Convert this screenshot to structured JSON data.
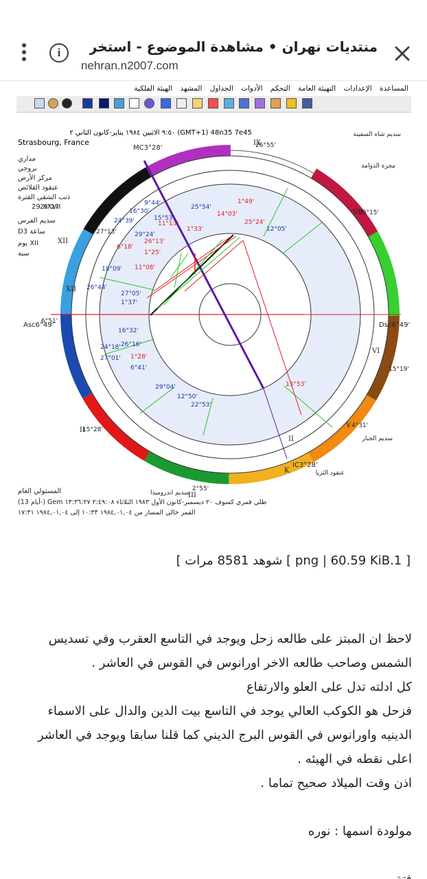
{
  "browser": {
    "title": "منتديات نهران • مشاهدة الموضوع - استخرج اس..",
    "url": "nehran.n2007.com"
  },
  "chart_app": {
    "menu": [
      "المساعدة",
      "الإعدادات",
      "التهيئة العامة",
      "التحكم",
      "الأدوات",
      "الجداول",
      "المشهد",
      "الهيئة الفلكية"
    ],
    "header_line1": "٩:٥٠ الاثنين ١٩٨٤ يناير-كانون الثاني ٢ (GMT+1) 48n35 7e45",
    "header_line2": "Strasbourg, France",
    "left_labels": [
      "مداري",
      "بروجي",
      "مركز الأرض",
      "عنقود القلائص",
      "ذنب الشقي الفترة",
      "29 XXVII",
      "سديم الفرس",
      "D3 ساعة",
      "يوم XII",
      "سنة"
    ],
    "right_labels": [
      "سديم شاه السفينة",
      "مجرة الدوامة",
      "سديم الجبار",
      "عنقود الثريا"
    ],
    "bottom_left": "المستولي العام",
    "bottom_line1": "سديم اندروميدا",
    "bottom_line2": "(أيام 13-) Gem طلي قمري كسوف ٢٠ ديسمبر-كانون الأول ١٩٨٣ الثلاثاء ٢:٤٩:٠٨ ١٣:٣٦:٢٧",
    "bottom_line3": "القمر خالي المسار من ١٩٨٤,٠١,٠٤ ١٠:٣٣ إلى ١٩٨٤,٠١,٠٤ ١٧:٣١",
    "angles": {
      "asc": "Asc6°49'",
      "dsc": "Dsc6°49'",
      "mc": "MC3°28'",
      "ic": "IC3°28'"
    },
    "degrees": [
      "25°54'",
      "14°03'",
      "1°49'",
      "15°53'",
      "11°13'",
      "1°33'",
      "25°24'",
      "12°05'",
      "9°44'",
      "16°30'",
      "24°39'",
      "29°24'",
      "26°13'",
      "6°18'",
      "1°25'",
      "18°09'",
      "11°08'",
      "26°44'",
      "27°05'",
      "1°37'",
      "16°32'",
      "24°18'",
      "26°16'",
      "27°01'",
      "1°28'",
      "6°41'",
      "29°04'",
      "12°50'",
      "22°53'",
      "15°53'",
      "2°55'",
      "15°28'",
      "27°13'",
      "26°55'",
      "15°19'",
      "4°31'",
      "29°27'",
      "29°15'",
      "6°51'"
    ]
  },
  "post": {
    "file_info": "[ png | 60.59 KiB.1 ] شوهد 8581 مرات ]",
    "paragraphs": [
      "لاحظ ان المبتز على طالعه زحل ويوجد في التاسع العقرب وفي تسديس",
      "الشمس وصاحب طالعه الاخر اورانوس في القوس في العاشر .",
      "كل ادلته تدل على العلو والارتفاع",
      "فزحل هو الكوكب العالي يوجد في التاسع بيت الدين والدال على الاسماء",
      "الدينيه واورانوس في القوس البرج الديني كما قلنا سابقا ويوجد في العاشر",
      "اعلى نقطه في الهيئه .",
      "اذن وقت الميلاد صحيح تماما .",
      "مولودة اسمها : نوره",
      "فتة"
    ]
  },
  "colors": {
    "accent_red": "#e02020",
    "accent_purple": "#5a1aa6",
    "inner_fill": "#e6ecfa"
  }
}
